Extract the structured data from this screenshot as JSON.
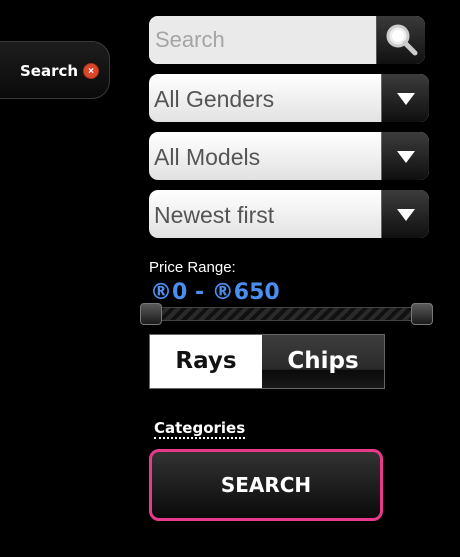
{
  "search_tab": {
    "label": "Search",
    "close_symbol": "×"
  },
  "search": {
    "placeholder": "Search",
    "icon": "magnifier-icon"
  },
  "filters": {
    "gender": {
      "value": "All Genders"
    },
    "model": {
      "value": "All Models"
    },
    "sort": {
      "value": "Newest first"
    }
  },
  "price": {
    "label": "Price Range:",
    "value_text": "®0 - ®650",
    "min": 0,
    "max": 650,
    "accent": "#4a8ff0"
  },
  "toggle": {
    "options": [
      {
        "label": "Rays",
        "selected": true
      },
      {
        "label": "Chips",
        "selected": false
      }
    ]
  },
  "categories": {
    "label": "Categories"
  },
  "submit": {
    "label": "SEARCH",
    "border_color": "#e83a8c"
  }
}
